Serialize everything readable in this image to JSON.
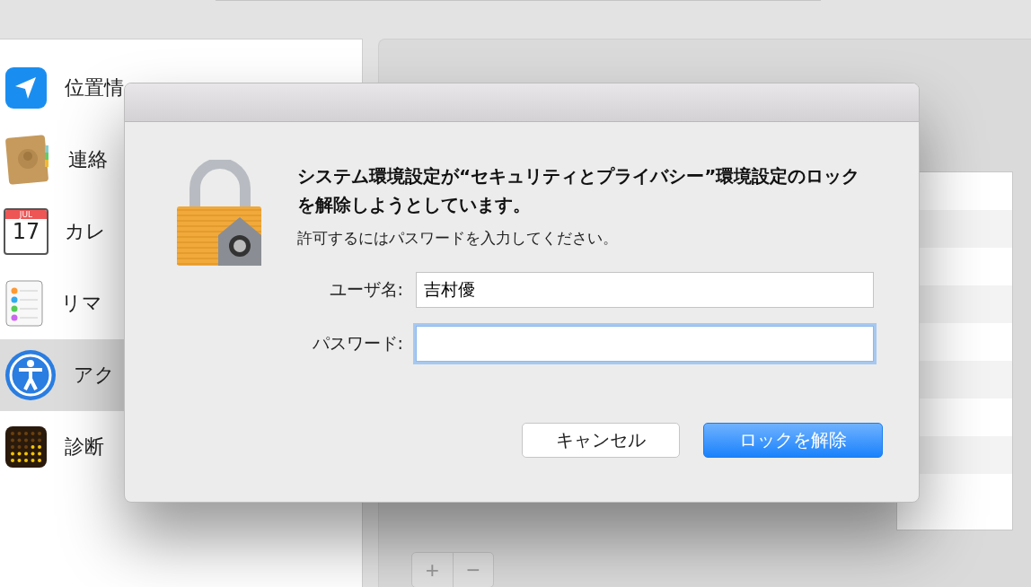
{
  "sidebar": {
    "items": [
      {
        "kind": "location",
        "label": "位置情",
        "selected": false
      },
      {
        "kind": "contacts",
        "label": "連絡",
        "selected": false
      },
      {
        "kind": "calendar",
        "label": "カレ",
        "month": "JUL",
        "day": "17",
        "selected": false
      },
      {
        "kind": "reminders",
        "label": "リマ",
        "selected": false
      },
      {
        "kind": "accessibility",
        "label": "アク",
        "selected": true
      },
      {
        "kind": "diagnostics",
        "label": "診断",
        "selected": false
      }
    ]
  },
  "panel": {
    "add": "+",
    "remove": "−"
  },
  "dialog": {
    "title": "システム環境設定が“セキュリティとプライバシー”環境設定のロックを解除しようとしています。",
    "message": "許可するにはパスワードを入力してください。",
    "fields": [
      {
        "label": "ユーザ名:",
        "value": "吉村優",
        "focused": false
      },
      {
        "label": "パスワード:",
        "focused": true
      }
    ],
    "buttons": [
      {
        "label": "キャンセル",
        "kind": "cancel"
      },
      {
        "label": "ロックを解除",
        "kind": "default"
      }
    ]
  }
}
